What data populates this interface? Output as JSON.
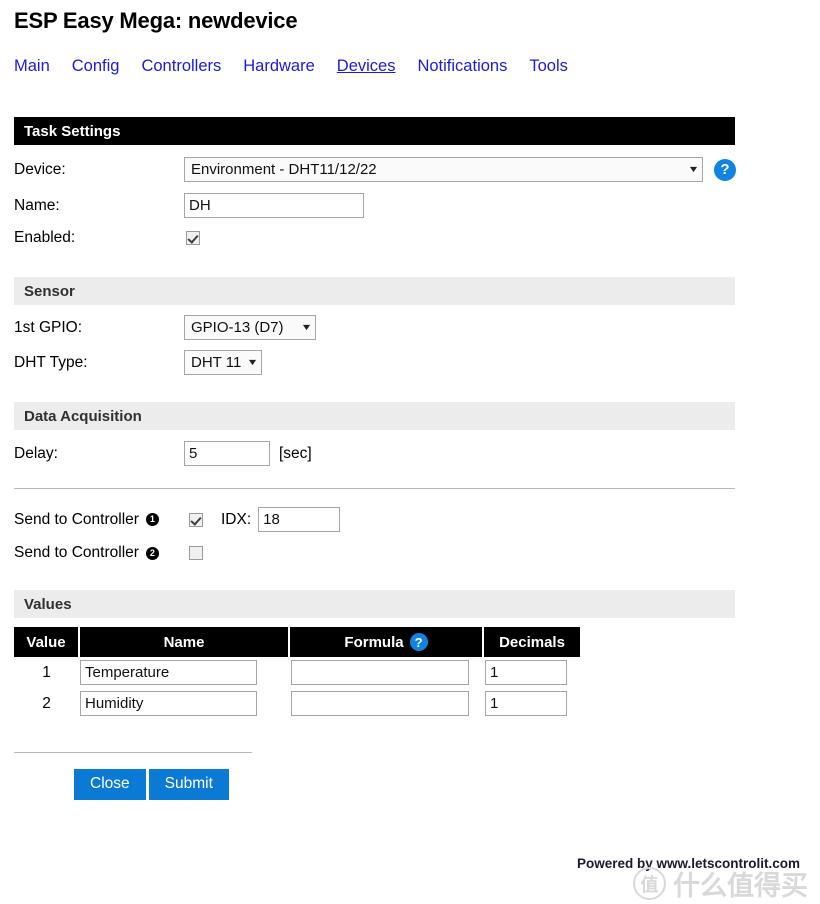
{
  "page": {
    "title": "ESP Easy Mega: newdevice"
  },
  "nav": {
    "items": [
      {
        "label": "Main",
        "active": false
      },
      {
        "label": "Config",
        "active": false
      },
      {
        "label": "Controllers",
        "active": false
      },
      {
        "label": "Hardware",
        "active": false
      },
      {
        "label": "Devices",
        "active": true
      },
      {
        "label": "Notifications",
        "active": false
      },
      {
        "label": "Tools",
        "active": false
      }
    ]
  },
  "task_settings": {
    "header": "Task Settings",
    "device": {
      "label": "Device:",
      "value": "Environment - DHT11/12/22",
      "caret": "▼",
      "help": "?"
    },
    "name": {
      "label": "Name:",
      "value": "DH"
    },
    "enabled": {
      "label": "Enabled:",
      "checked": true
    }
  },
  "sensor": {
    "header": "Sensor",
    "gpio": {
      "label": "1st GPIO:",
      "value": "GPIO-13 (D7)",
      "caret": "▼"
    },
    "dht_type": {
      "label": "DHT Type:",
      "value": "DHT 11",
      "caret": "▼"
    }
  },
  "data_acquisition": {
    "header": "Data Acquisition",
    "delay": {
      "label": "Delay:",
      "value": "5",
      "unit": "[sec]"
    },
    "controller1": {
      "label": "Send to Controller",
      "badge": "1",
      "checked": true,
      "idx_label": "IDX:",
      "idx_value": "18"
    },
    "controller2": {
      "label": "Send to Controller",
      "badge": "2",
      "checked": false
    }
  },
  "values": {
    "header": "Values",
    "columns": [
      "Value",
      "Name",
      "Formula",
      "Decimals"
    ],
    "formula_help": "?",
    "rows": [
      {
        "index": "1",
        "name": "Temperature",
        "formula": "",
        "decimals": "1"
      },
      {
        "index": "2",
        "name": "Humidity",
        "formula": "",
        "decimals": "1"
      }
    ]
  },
  "actions": {
    "close": "Close",
    "submit": "Submit"
  },
  "footer": {
    "text": "Powered by www.letscontrolit.com",
    "watermark_mark": "值",
    "watermark_text": "什么值得买"
  },
  "colors": {
    "link": "#1a1ae0",
    "accent_blue": "#0b7ad5",
    "help_blue": "#1084e0",
    "section_dark": "#000000",
    "section_light": "#ececec"
  }
}
